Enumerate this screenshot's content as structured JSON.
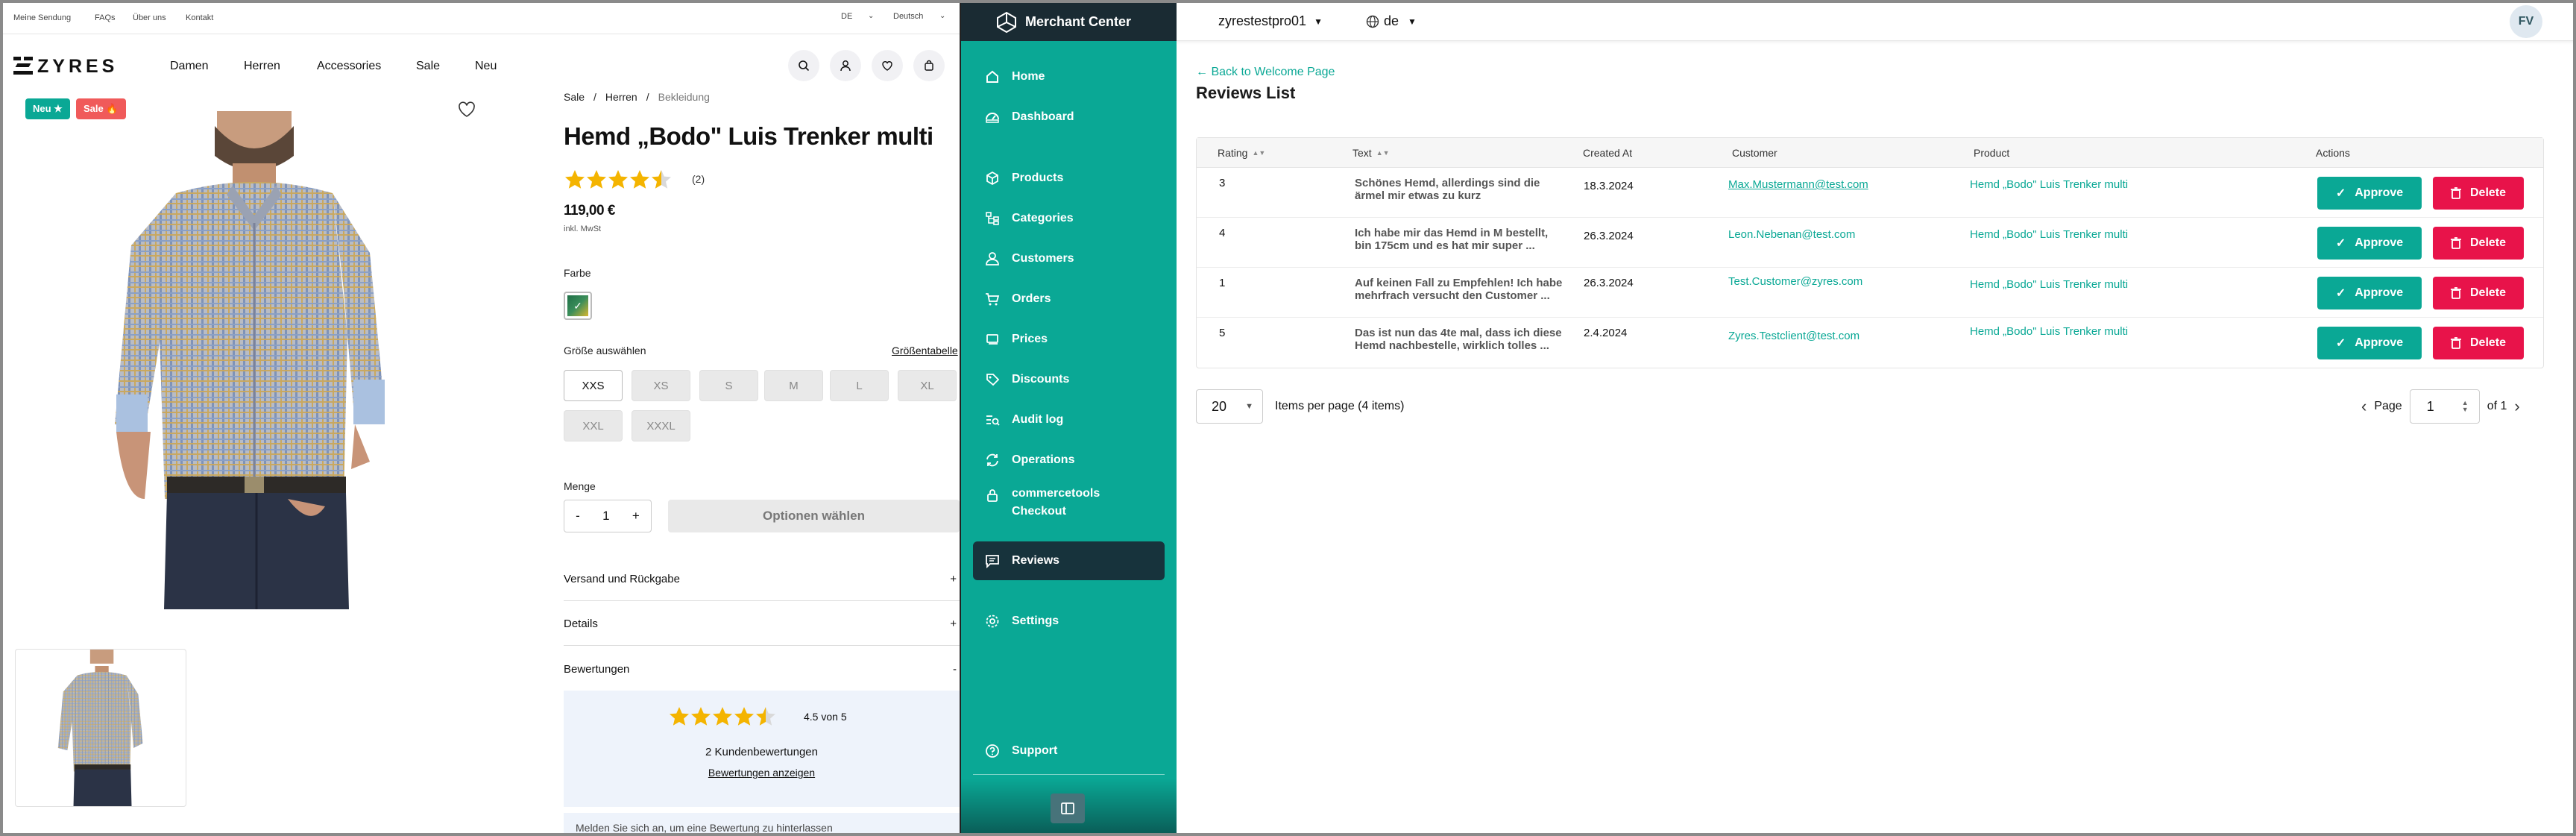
{
  "shop": {
    "topbar": {
      "links": [
        "Meine Sendung",
        "FAQs",
        "Über uns",
        "Kontakt"
      ],
      "country": "DE",
      "language": "Deutsch"
    },
    "logo_text": "ZYRES",
    "nav": [
      "Damen",
      "Herren",
      "Accessories",
      "Sale",
      "Neu"
    ],
    "badges": {
      "new": "Neu ★",
      "sale": "Sale 🔥"
    },
    "breadcrumb": [
      "Sale",
      "Herren",
      "Bekleidung"
    ],
    "product": {
      "title": "Hemd „Bodo\" Luis Trenker multi",
      "rating": 4.5,
      "rating_count": "(2)",
      "price": "119,00 €",
      "vat_note": "inkl. MwSt",
      "color_label": "Farbe",
      "size_label": "Größe auswählen",
      "size_chart_link": "Größentabelle",
      "sizes": [
        "XXS",
        "XS",
        "S",
        "M",
        "L",
        "XL",
        "XXL",
        "XXXL"
      ],
      "quantity_label": "Menge",
      "quantity": "1",
      "qty_minus": "-",
      "qty_plus": "+",
      "options_button": "Optionen wählen"
    },
    "accordion": [
      {
        "label": "Versand und Rückgabe",
        "sign": "+"
      },
      {
        "label": "Details",
        "sign": "+"
      },
      {
        "label": "Bewertungen",
        "sign": "-"
      }
    ],
    "reviews_box": {
      "score_text": "4.5 von 5",
      "count_text": "2 Kundenbewertungen",
      "show_link": "Bewertungen anzeigen",
      "login_note": "Melden Sie sich an, um eine Bewertung zu hinterlassen"
    }
  },
  "sidebar": {
    "app_title": "Merchant Center",
    "items": [
      {
        "label": "Home",
        "icon": "home-icon"
      },
      {
        "label": "Dashboard",
        "icon": "dashboard-icon"
      },
      {
        "label": "Products",
        "icon": "cube-icon"
      },
      {
        "label": "Categories",
        "icon": "tree-icon"
      },
      {
        "label": "Customers",
        "icon": "user-icon"
      },
      {
        "label": "Orders",
        "icon": "cart-icon"
      },
      {
        "label": "Prices",
        "icon": "tag-icon"
      },
      {
        "label": "Discounts",
        "icon": "discount-icon"
      },
      {
        "label": "Audit log",
        "icon": "audit-icon"
      },
      {
        "label": "Operations",
        "icon": "refresh-icon"
      },
      {
        "label": "commercetools\nCheckout",
        "icon": "lock-icon"
      },
      {
        "label": "Reviews",
        "icon": "reviews-icon",
        "active": true
      },
      {
        "label": "Settings",
        "icon": "gear-icon"
      }
    ],
    "support": "Support"
  },
  "merchant": {
    "project": "zyrestestpro01",
    "language": "de",
    "avatar": "FV",
    "back_link": "← Back to Welcome Page",
    "page_title": "Reviews List",
    "columns": [
      "Rating",
      "Text",
      "Created At",
      "Customer",
      "Product",
      "Actions"
    ],
    "rows": [
      {
        "rating": "3",
        "text1": "Schönes Hemd, allerdings sind die",
        "text2": "ärmel mir etwas zu kurz",
        "created": "18.3.2024",
        "customer": "Max.Mustermann@test.com",
        "product": "Hemd „Bodo\" Luis Trenker multi"
      },
      {
        "rating": "4",
        "text1": "Ich habe mir das Hemd in M bestellt,",
        "text2": "bin 175cm und es hat mir super ...",
        "created": "26.3.2024",
        "customer": "Leon.Nebenan@test.com",
        "product": "Hemd „Bodo\" Luis Trenker multi"
      },
      {
        "rating": "1",
        "text1": "Auf keinen Fall zu Empfehlen! Ich habe",
        "text2": "mehrfrach versucht den Customer ...",
        "created": "26.3.2024",
        "customer": "Test.Customer@zyres.com",
        "product": "Hemd „Bodo\" Luis Trenker multi"
      },
      {
        "rating": "5",
        "text1": "Das ist nun das 4te mal, dass ich diese",
        "text2": "Hemd nachbestelle, wirklich tolles ...",
        "created": "2.4.2024",
        "customer": "Zyres.Testclient@test.com",
        "product": "Hemd „Bodo\" Luis Trenker multi"
      }
    ],
    "approve": "Approve",
    "delete": "Delete",
    "per_page": "20",
    "per_page_label": "Items per page (4 items)",
    "page_label": "Page",
    "page_value": "1",
    "of_label": "of 1"
  },
  "colors": {
    "teal": "#0aa895",
    "dark": "#1a2b33",
    "danger": "#e8134a",
    "star": "#f4b400"
  }
}
